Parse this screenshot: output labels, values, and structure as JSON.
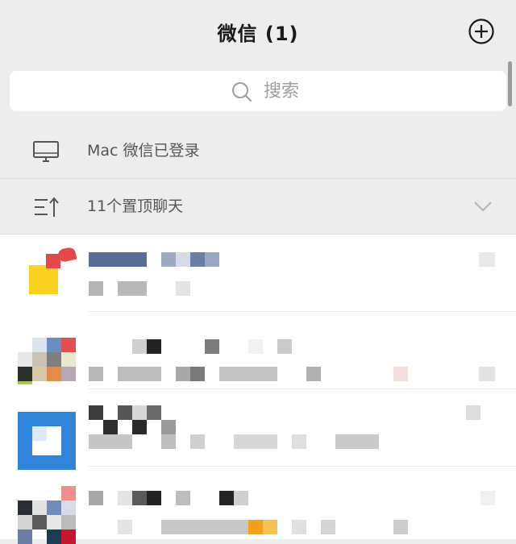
{
  "header": {
    "title": "微信 (1)",
    "add_icon": "plus-circle-icon"
  },
  "search": {
    "placeholder": "搜索",
    "icon": "search-icon"
  },
  "mac_login": {
    "label": "Mac 微信已登录",
    "icon": "desktop-icon"
  },
  "pinned": {
    "label": "11个置顶聊天",
    "icon": "sort-up-icon",
    "chevron": "chevron-down-icon"
  },
  "chats": [
    {
      "id": "chat-1",
      "avatar": "pixelated-avatar",
      "preview": "pixelated"
    },
    {
      "id": "chat-2",
      "avatar": "pixelated-avatar",
      "preview": "pixelated"
    },
    {
      "id": "chat-3",
      "avatar": "pixelated-avatar",
      "preview": "pixelated"
    },
    {
      "id": "chat-4",
      "avatar": "pixelated-avatar",
      "preview": "pixelated"
    }
  ],
  "colors": {
    "background": "#ededed",
    "surface": "#ffffff",
    "accent_blue": "#2f84d8",
    "pin_red": "#e54848",
    "avatar_yellow": "#f9d11e"
  }
}
